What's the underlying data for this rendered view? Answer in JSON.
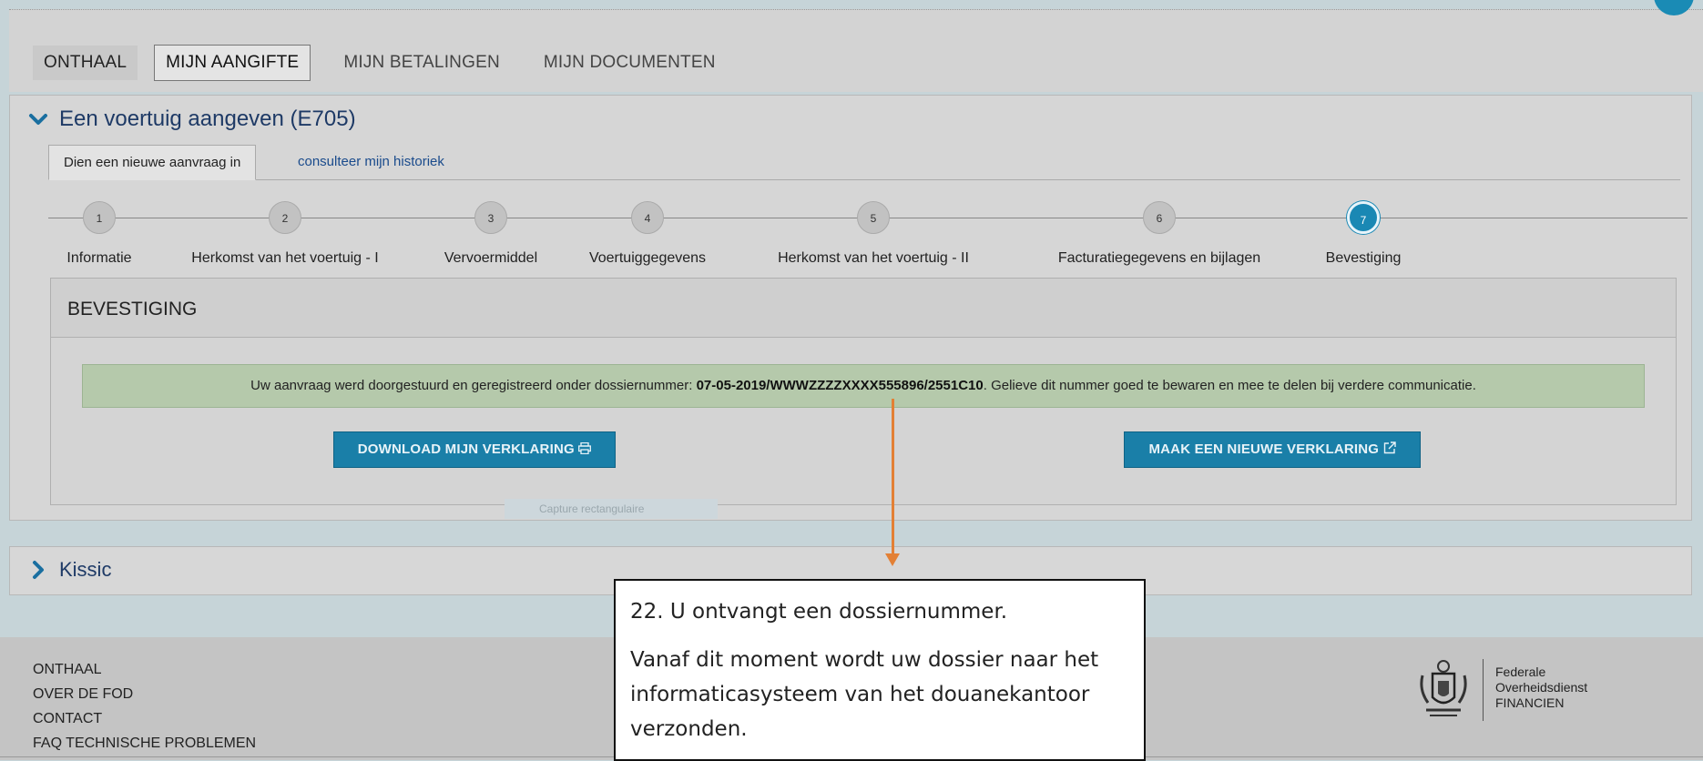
{
  "nav": {
    "home": "ONTHAAL",
    "declaration": "MIJN AANGIFTE",
    "payments": "MIJN BETALINGEN",
    "documents": "MIJN DOCUMENTEN"
  },
  "panel": {
    "title": "Een voertuig aangeven (E705)",
    "tab_new": "Dien een nieuwe aanvraag in",
    "tab_history": "consulteer mijn historiek"
  },
  "steps": [
    {
      "num": "1",
      "label": "Informatie"
    },
    {
      "num": "2",
      "label": "Herkomst van het voertuig - I"
    },
    {
      "num": "3",
      "label": "Vervoermiddel"
    },
    {
      "num": "4",
      "label": "Voertuiggegevens"
    },
    {
      "num": "5",
      "label": "Herkomst van het voertuig - II"
    },
    {
      "num": "6",
      "label": "Facturatiegegevens en bijlagen"
    },
    {
      "num": "7",
      "label": "Bevestiging"
    }
  ],
  "active_step": 7,
  "confirmation": {
    "title": "BEVESTIGING",
    "message_before": "Uw aanvraag werd doorgestuurd en geregistreerd onder dossiernummer: ",
    "dossier_number": "07-05-2019/WWWZZZZXXXX555896/2551C10",
    "message_after": ". Gelieve dit nummer goed te bewaren en mee te delen bij verdere communicatie.",
    "download_button": "DOWNLOAD MIJN VERKLARING",
    "new_button": "MAAK EEN NIEUWE VERKLARING",
    "ghost_label": "Capture rectangulaire"
  },
  "kissic": {
    "title": "Kissic"
  },
  "footer": {
    "links": [
      "ONTHAAL",
      "OVER DE FOD",
      "CONTACT",
      "FAQ TECHNISCHE PROBLEMEN"
    ],
    "logo_line1": "Federale",
    "logo_line2": "Overheidsdienst",
    "logo_line3": "FINANCIEN"
  },
  "callout": {
    "line1": "22. U ontvangt een dossiernummer.",
    "line2": "Vanaf dit moment wordt uw dossier naar het informaticasysteem van het douanekantoor verzonden."
  },
  "colors": {
    "accent": "#1a7fa8",
    "arrow": "#e38035",
    "title_blue": "#1e3a66",
    "success_bg": "#b5c9ab"
  }
}
